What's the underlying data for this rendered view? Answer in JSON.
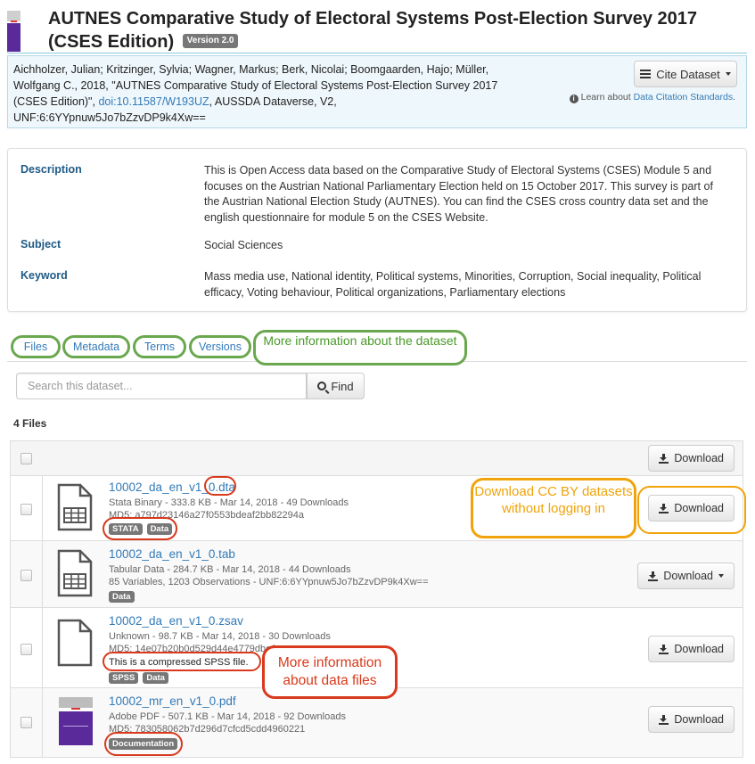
{
  "header": {
    "title": "AUTNES Comparative Study of Electoral Systems Post-Election Survey 2017 (CSES Edition)",
    "version_badge": "Version 2.0"
  },
  "citation": {
    "text_before_doi": "Aichholzer, Julian; Kritzinger, Sylvia; Wagner, Markus; Berk, Nicolai; Boomgaarden, Hajo; Müller, Wolfgang C., 2018, \"AUTNES Comparative Study of Electoral Systems Post-Election Survey 2017 (CSES Edition)\", ",
    "doi_link": "doi:10.11587/W193UZ",
    "text_after_doi": ", AUSSDA Dataverse, V2, UNF:6:6YYpnuw5Jo7bZzvDP9k4Xw==",
    "cite_button": "Cite Dataset",
    "learn_prefix": "Learn about ",
    "learn_link": "Data Citation Standards",
    "learn_suffix": "."
  },
  "metadata": {
    "description_label": "Description",
    "description_value": "This is Open Access data based on the Comparative Study of Electoral Systems (CSES) Module 5 and focuses on the Austrian National Parliamentary Election held on 15 October 2017. This survey is part of the Austrian National Election Study (AUTNES). You can find the CSES cross country data set and the english questionnaire for module 5 on the CSES Website.",
    "subject_label": "Subject",
    "subject_value": "Social Sciences",
    "keyword_label": "Keyword",
    "keyword_value": "Mass media use, National identity, Political systems, Minorities, Corruption, Social inequality, Political efficacy, Voting behaviour, Political organizations, Parliamentary elections"
  },
  "tabs": [
    {
      "label": "Files"
    },
    {
      "label": "Metadata"
    },
    {
      "label": "Terms"
    },
    {
      "label": "Versions"
    }
  ],
  "search": {
    "placeholder": "Search this dataset...",
    "find_button": "Find"
  },
  "files_count": "4 Files",
  "download_all_button": "Download",
  "files": [
    {
      "name": "10002_da_en_v1_0.dta",
      "icon": "tabular-file-icon",
      "meta_line": "Stata Binary - 333.8 KB - Mar 14, 2018 - 49 Downloads",
      "second_line": "MD5: a797d23146a27f0553bdeaf2bb82294a",
      "tags": [
        "STATA",
        "Data"
      ],
      "download_label": "Download",
      "has_dropdown": false
    },
    {
      "name": "10002_da_en_v1_0.tab",
      "icon": "tabular-file-icon",
      "meta_line": "Tabular Data - 284.7 KB - Mar 14, 2018 - 44 Downloads",
      "second_line": "85 Variables, 1203 Observations - UNF:6:6YYpnuw5Jo7bZzvDP9k4Xw==",
      "tags": [
        "Data"
      ],
      "download_label": "Download",
      "has_dropdown": true
    },
    {
      "name": "10002_da_en_v1_0.zsav",
      "icon": "blank-file-icon",
      "meta_line": "Unknown - 98.7 KB - Mar 14, 2018 - 30 Downloads",
      "second_line": "MD5: 14e07b20b0d529d44e4779dbe0",
      "description": "This is a compressed SPSS file.",
      "tags": [
        "SPSS",
        "Data"
      ],
      "download_label": "Download",
      "has_dropdown": false
    },
    {
      "name": "10002_mr_en_v1_0.pdf",
      "icon": "pdf-thumbnail-icon",
      "meta_line": "Adobe PDF - 507.1 KB - Mar 14, 2018 - 92 Downloads",
      "second_line": "MD5: 783058062b7d296d7cfcd5cdd4960221",
      "tags": [
        "Documentation"
      ],
      "download_label": "Download",
      "has_dropdown": false
    }
  ],
  "annotations": {
    "green_callout": "More information about the dataset",
    "orange_callout": "Download CC BY datasets without logging in",
    "red_callout": "More information about data files",
    "colors": {
      "green": "#6aa84f",
      "orange": "#f0a30a",
      "red": "#d9391c"
    }
  },
  "colors": {
    "link": "#337ab7",
    "label": "#1f5b85",
    "citation_bg": "#eef7fb",
    "badge": "#777777"
  }
}
